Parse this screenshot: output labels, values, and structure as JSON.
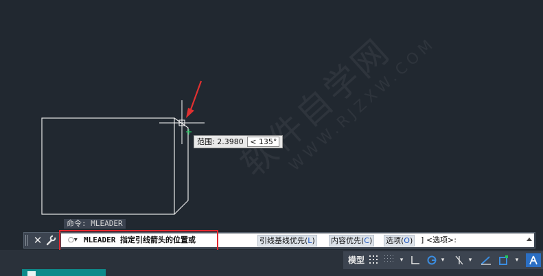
{
  "tooltip": {
    "label": "范围: 2.3980",
    "angle": "< 135°"
  },
  "command_history": "命令: MLEADER",
  "command_line": {
    "command": "MLEADER 指定引线箭头的位置或",
    "options": [
      {
        "text": "引线基线优先(",
        "key": "L",
        "end": ")"
      },
      {
        "text": "内容优先(",
        "key": "C",
        "end": ")"
      },
      {
        "text": "选项(",
        "key": "O",
        "end": ")"
      }
    ],
    "suffix": "] <选项>:"
  },
  "statusbar": {
    "model_label": "模型"
  },
  "watermark": {
    "main": "软件自学网",
    "url": "WWW.RJZXW.COM"
  },
  "colors": {
    "canvas": "#212830",
    "highlight": "#e3262e",
    "arrow": "#e03030",
    "crosshair": "#ffffff",
    "snap": "#22c55e"
  }
}
